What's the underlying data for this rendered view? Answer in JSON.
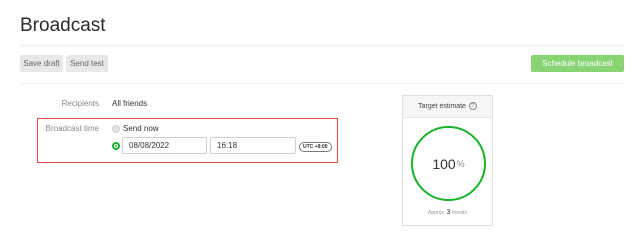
{
  "page": {
    "title": "Broadcast"
  },
  "toolbar": {
    "save_draft_label": "Save draft",
    "send_test_label": "Send test",
    "schedule_label": "Schedule broadcast"
  },
  "form": {
    "recipients_label": "Recipients",
    "recipients_value": "All friends",
    "broadcast_time_label": "Broadcast time",
    "send_now_label": "Send now",
    "date_value": "08/08/2022",
    "time_value": "16:18",
    "timezone": "UTC +8:00",
    "selected_option": "scheduled"
  },
  "estimate": {
    "header": "Target estimate",
    "percent": "100",
    "percent_sign": "%",
    "approx_prefix": "Approx.",
    "approx_count": "3",
    "approx_suffix": "friends"
  },
  "colors": {
    "accent": "#19b22d",
    "schedule_button": "#88d474",
    "highlight": "#e24a4a"
  },
  "icons": {
    "info": "info-icon"
  }
}
